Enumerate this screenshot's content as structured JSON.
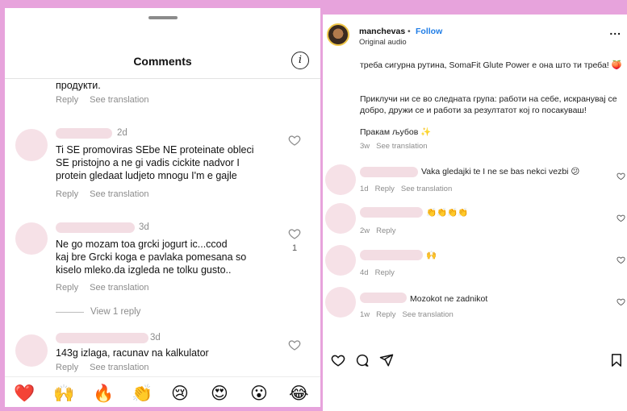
{
  "left": {
    "title": "Comments",
    "partial_comment": {
      "text": "продукти.",
      "reply": "Reply",
      "translation": "See translation"
    },
    "comments": [
      {
        "time": "2d",
        "lines": [
          "Ti SE promoviras SEbe NE proteinate oblеci",
          "SE pristojno a ne gi vadis cickite nadvor I",
          "protein gledaat ludjeto mnogu I'm е gajle"
        ],
        "reply": "Reply",
        "translation": "See translation"
      },
      {
        "time": "3d",
        "lines": [
          "Ne go mozam toa grcki jogurt ic...ccod",
          "kaj  bre Grcki koga e pavlaka pomesana so",
          "kiselo mleko.da izgleda ne tolku gusto.."
        ],
        "reply": "Reply",
        "translation": "See translation",
        "likes": "1",
        "view_replies": "View 1 reply"
      },
      {
        "time": "3d",
        "lines": [
          "143g izlaga, racunav na kalkulator"
        ],
        "reply": "Reply",
        "translation": "See translation"
      }
    ],
    "emojis": [
      "❤️",
      "🙌",
      "🔥",
      "👏",
      "😢",
      "😍",
      "😮",
      "😂"
    ]
  },
  "right": {
    "username": "manchevas",
    "dot": "•",
    "follow": "Follow",
    "audio": "Original audio",
    "more": "...",
    "caption1": "треба сигурна рутина, SomaFit Glute Power е она што ти треба! 🍑",
    "caption2": "Приклучи ни се во следната група: работи на себе, искранувај се добро, дружи се и работи за резултатот кој го посакуваш!",
    "caption3": "Пракам љубов ✨",
    "caption_time": "3w",
    "caption_translation": "See translation",
    "comments": [
      {
        "text": "Vaka gledajki te I ne se bas nekci vezbi 😕",
        "time": "1d",
        "reply": "Reply",
        "translation": "See translation"
      },
      {
        "text": "👏👏👏👏",
        "time": "2w",
        "reply": "Reply"
      },
      {
        "text": "🙌",
        "time": "4d",
        "reply": "Reply"
      },
      {
        "text": "Mozokot ne zadnikot",
        "time": "1w",
        "reply": "Reply",
        "translation": "See translation"
      }
    ]
  }
}
